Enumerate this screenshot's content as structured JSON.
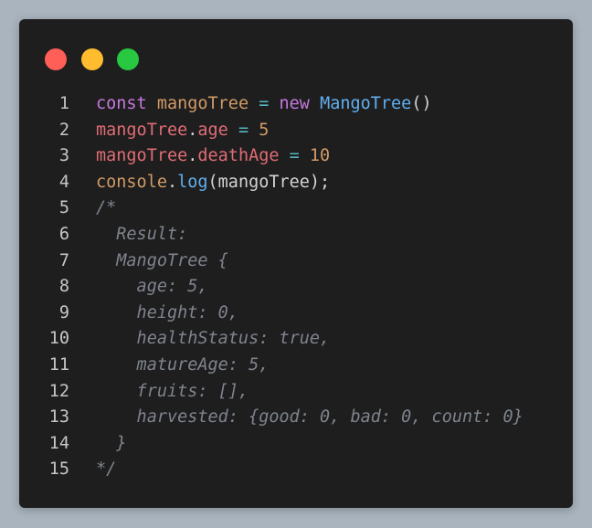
{
  "window": {
    "controls": [
      {
        "name": "close",
        "color": "#ff5f57"
      },
      {
        "name": "minimize",
        "color": "#febc2e"
      },
      {
        "name": "maximize",
        "color": "#28c840"
      }
    ]
  },
  "code": {
    "lines": [
      {
        "number": "1",
        "tokens": [
          {
            "t": "const",
            "c": "kw"
          },
          {
            "t": " ",
            "c": "txt"
          },
          {
            "t": "mangoTree",
            "c": "num"
          },
          {
            "t": " ",
            "c": "txt"
          },
          {
            "t": "=",
            "c": "op"
          },
          {
            "t": " ",
            "c": "txt"
          },
          {
            "t": "new",
            "c": "kw"
          },
          {
            "t": " ",
            "c": "txt"
          },
          {
            "t": "MangoTree",
            "c": "cls"
          },
          {
            "t": "()",
            "c": "punc"
          }
        ]
      },
      {
        "number": "2",
        "tokens": [
          {
            "t": "mangoTree",
            "c": "var"
          },
          {
            "t": ".",
            "c": "punc"
          },
          {
            "t": "age",
            "c": "var"
          },
          {
            "t": " ",
            "c": "txt"
          },
          {
            "t": "=",
            "c": "op"
          },
          {
            "t": " ",
            "c": "txt"
          },
          {
            "t": "5",
            "c": "num"
          }
        ]
      },
      {
        "number": "3",
        "tokens": [
          {
            "t": "mangoTree",
            "c": "var"
          },
          {
            "t": ".",
            "c": "punc"
          },
          {
            "t": "deathAge",
            "c": "var"
          },
          {
            "t": " ",
            "c": "txt"
          },
          {
            "t": "=",
            "c": "op"
          },
          {
            "t": " ",
            "c": "txt"
          },
          {
            "t": "10",
            "c": "num"
          }
        ]
      },
      {
        "number": "4",
        "tokens": [
          {
            "t": "console",
            "c": "num"
          },
          {
            "t": ".",
            "c": "punc"
          },
          {
            "t": "log",
            "c": "fn"
          },
          {
            "t": "(mangoTree);",
            "c": "punc"
          }
        ]
      },
      {
        "number": "5",
        "tokens": [
          {
            "t": "/*",
            "c": "comment"
          }
        ]
      },
      {
        "number": "6",
        "tokens": [
          {
            "t": "  Result:",
            "c": "comment"
          }
        ]
      },
      {
        "number": "7",
        "tokens": [
          {
            "t": "  MangoTree {",
            "c": "comment"
          }
        ]
      },
      {
        "number": "8",
        "tokens": [
          {
            "t": "    age: 5,",
            "c": "comment"
          }
        ]
      },
      {
        "number": "9",
        "tokens": [
          {
            "t": "    height: 0,",
            "c": "comment"
          }
        ]
      },
      {
        "number": "10",
        "tokens": [
          {
            "t": "    healthStatus: true,",
            "c": "comment"
          }
        ]
      },
      {
        "number": "11",
        "tokens": [
          {
            "t": "    matureAge: 5,",
            "c": "comment"
          }
        ]
      },
      {
        "number": "12",
        "tokens": [
          {
            "t": "    fruits: [],",
            "c": "comment"
          }
        ]
      },
      {
        "number": "13",
        "tokens": [
          {
            "t": "    harvested: {good: 0, bad: 0, count: 0}",
            "c": "comment"
          }
        ]
      },
      {
        "number": "14",
        "tokens": [
          {
            "t": "  }",
            "c": "comment"
          }
        ]
      },
      {
        "number": "15",
        "tokens": [
          {
            "t": "*/",
            "c": "comment"
          }
        ]
      }
    ]
  }
}
